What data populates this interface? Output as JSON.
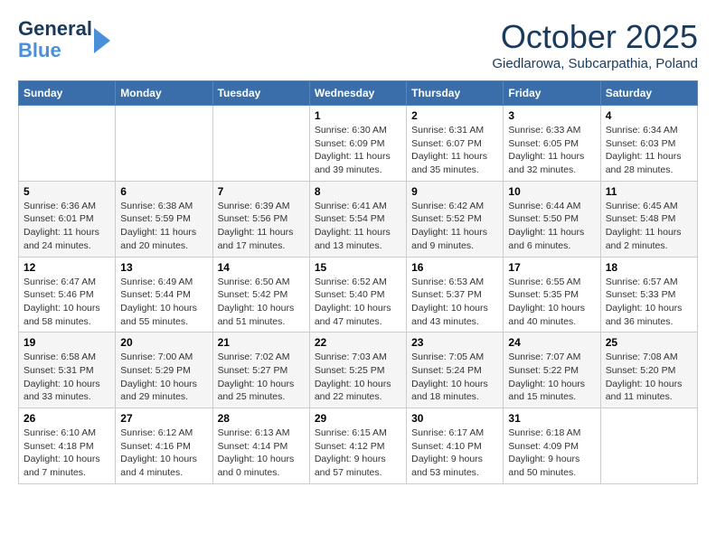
{
  "header": {
    "logo_line1": "General",
    "logo_line2": "Blue",
    "month": "October 2025",
    "location": "Giedlarowa, Subcarpathia, Poland"
  },
  "weekdays": [
    "Sunday",
    "Monday",
    "Tuesday",
    "Wednesday",
    "Thursday",
    "Friday",
    "Saturday"
  ],
  "weeks": [
    [
      {
        "day": "",
        "info": ""
      },
      {
        "day": "",
        "info": ""
      },
      {
        "day": "",
        "info": ""
      },
      {
        "day": "1",
        "info": "Sunrise: 6:30 AM\nSunset: 6:09 PM\nDaylight: 11 hours\nand 39 minutes."
      },
      {
        "day": "2",
        "info": "Sunrise: 6:31 AM\nSunset: 6:07 PM\nDaylight: 11 hours\nand 35 minutes."
      },
      {
        "day": "3",
        "info": "Sunrise: 6:33 AM\nSunset: 6:05 PM\nDaylight: 11 hours\nand 32 minutes."
      },
      {
        "day": "4",
        "info": "Sunrise: 6:34 AM\nSunset: 6:03 PM\nDaylight: 11 hours\nand 28 minutes."
      }
    ],
    [
      {
        "day": "5",
        "info": "Sunrise: 6:36 AM\nSunset: 6:01 PM\nDaylight: 11 hours\nand 24 minutes."
      },
      {
        "day": "6",
        "info": "Sunrise: 6:38 AM\nSunset: 5:59 PM\nDaylight: 11 hours\nand 20 minutes."
      },
      {
        "day": "7",
        "info": "Sunrise: 6:39 AM\nSunset: 5:56 PM\nDaylight: 11 hours\nand 17 minutes."
      },
      {
        "day": "8",
        "info": "Sunrise: 6:41 AM\nSunset: 5:54 PM\nDaylight: 11 hours\nand 13 minutes."
      },
      {
        "day": "9",
        "info": "Sunrise: 6:42 AM\nSunset: 5:52 PM\nDaylight: 11 hours\nand 9 minutes."
      },
      {
        "day": "10",
        "info": "Sunrise: 6:44 AM\nSunset: 5:50 PM\nDaylight: 11 hours\nand 6 minutes."
      },
      {
        "day": "11",
        "info": "Sunrise: 6:45 AM\nSunset: 5:48 PM\nDaylight: 11 hours\nand 2 minutes."
      }
    ],
    [
      {
        "day": "12",
        "info": "Sunrise: 6:47 AM\nSunset: 5:46 PM\nDaylight: 10 hours\nand 58 minutes."
      },
      {
        "day": "13",
        "info": "Sunrise: 6:49 AM\nSunset: 5:44 PM\nDaylight: 10 hours\nand 55 minutes."
      },
      {
        "day": "14",
        "info": "Sunrise: 6:50 AM\nSunset: 5:42 PM\nDaylight: 10 hours\nand 51 minutes."
      },
      {
        "day": "15",
        "info": "Sunrise: 6:52 AM\nSunset: 5:40 PM\nDaylight: 10 hours\nand 47 minutes."
      },
      {
        "day": "16",
        "info": "Sunrise: 6:53 AM\nSunset: 5:37 PM\nDaylight: 10 hours\nand 43 minutes."
      },
      {
        "day": "17",
        "info": "Sunrise: 6:55 AM\nSunset: 5:35 PM\nDaylight: 10 hours\nand 40 minutes."
      },
      {
        "day": "18",
        "info": "Sunrise: 6:57 AM\nSunset: 5:33 PM\nDaylight: 10 hours\nand 36 minutes."
      }
    ],
    [
      {
        "day": "19",
        "info": "Sunrise: 6:58 AM\nSunset: 5:31 PM\nDaylight: 10 hours\nand 33 minutes."
      },
      {
        "day": "20",
        "info": "Sunrise: 7:00 AM\nSunset: 5:29 PM\nDaylight: 10 hours\nand 29 minutes."
      },
      {
        "day": "21",
        "info": "Sunrise: 7:02 AM\nSunset: 5:27 PM\nDaylight: 10 hours\nand 25 minutes."
      },
      {
        "day": "22",
        "info": "Sunrise: 7:03 AM\nSunset: 5:25 PM\nDaylight: 10 hours\nand 22 minutes."
      },
      {
        "day": "23",
        "info": "Sunrise: 7:05 AM\nSunset: 5:24 PM\nDaylight: 10 hours\nand 18 minutes."
      },
      {
        "day": "24",
        "info": "Sunrise: 7:07 AM\nSunset: 5:22 PM\nDaylight: 10 hours\nand 15 minutes."
      },
      {
        "day": "25",
        "info": "Sunrise: 7:08 AM\nSunset: 5:20 PM\nDaylight: 10 hours\nand 11 minutes."
      }
    ],
    [
      {
        "day": "26",
        "info": "Sunrise: 6:10 AM\nSunset: 4:18 PM\nDaylight: 10 hours\nand 7 minutes."
      },
      {
        "day": "27",
        "info": "Sunrise: 6:12 AM\nSunset: 4:16 PM\nDaylight: 10 hours\nand 4 minutes."
      },
      {
        "day": "28",
        "info": "Sunrise: 6:13 AM\nSunset: 4:14 PM\nDaylight: 10 hours\nand 0 minutes."
      },
      {
        "day": "29",
        "info": "Sunrise: 6:15 AM\nSunset: 4:12 PM\nDaylight: 9 hours\nand 57 minutes."
      },
      {
        "day": "30",
        "info": "Sunrise: 6:17 AM\nSunset: 4:10 PM\nDaylight: 9 hours\nand 53 minutes."
      },
      {
        "day": "31",
        "info": "Sunrise: 6:18 AM\nSunset: 4:09 PM\nDaylight: 9 hours\nand 50 minutes."
      },
      {
        "day": "",
        "info": ""
      }
    ]
  ]
}
